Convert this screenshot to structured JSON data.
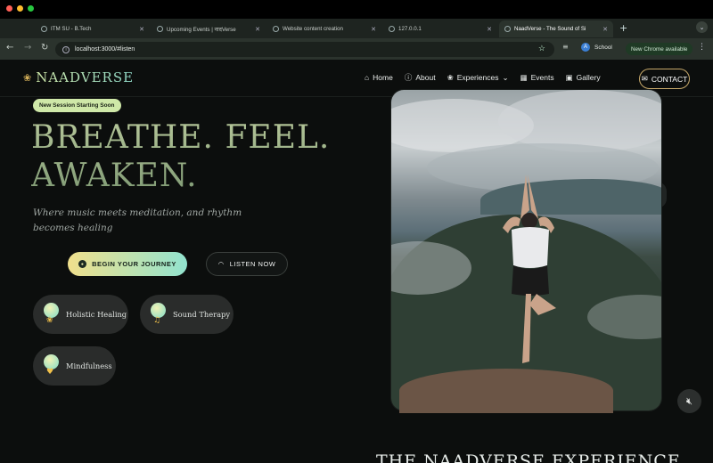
{
  "browser": {
    "tabs": [
      {
        "label": "ITM SU - B.Tech"
      },
      {
        "label": "Upcoming Events | नादVerse"
      },
      {
        "label": "Website content creation"
      },
      {
        "label": "127.0.0.1"
      },
      {
        "label": "NaadVerse - The Sound of Si"
      }
    ],
    "url": "localhost:3000/#listen",
    "profile_initial": "A",
    "profile_name": "School",
    "update_label": "New Chrome available"
  },
  "site": {
    "brand": "NAADVERSE",
    "nav": [
      {
        "label": "Home",
        "icon": "home-icon"
      },
      {
        "label": "About",
        "icon": "info-icon"
      },
      {
        "label": "Experiences",
        "icon": "lotus-icon"
      },
      {
        "label": "Events",
        "icon": "calendar-icon"
      },
      {
        "label": "Gallery",
        "icon": "gallery-icon"
      }
    ],
    "contact_label": "CONTACT",
    "session_badge": "New Session Starting Soon",
    "hero_line1": "BREATHE. FEEL.",
    "hero_line2": "AWAKEN.",
    "hero_sub": "Where music meets meditation, and rhythm becomes healing",
    "cta_primary": "BEGIN YOUR JOURNEY",
    "cta_secondary": "LISTEN NOW",
    "features": [
      {
        "label": "Holistic Healing",
        "icon": "lotus-icon"
      },
      {
        "label": "Sound Therapy",
        "icon": "music-note-icon"
      },
      {
        "label": "Mindfulness",
        "icon": "heart-icon"
      }
    ],
    "section_heading": "THE NAADVERSE EXPERIENCE"
  },
  "colors": {
    "accent_gold": "#c6a86a",
    "accent_mint": "#92e3cf",
    "accent_cream": "#f0e08c",
    "background": "#0c0e0d"
  }
}
